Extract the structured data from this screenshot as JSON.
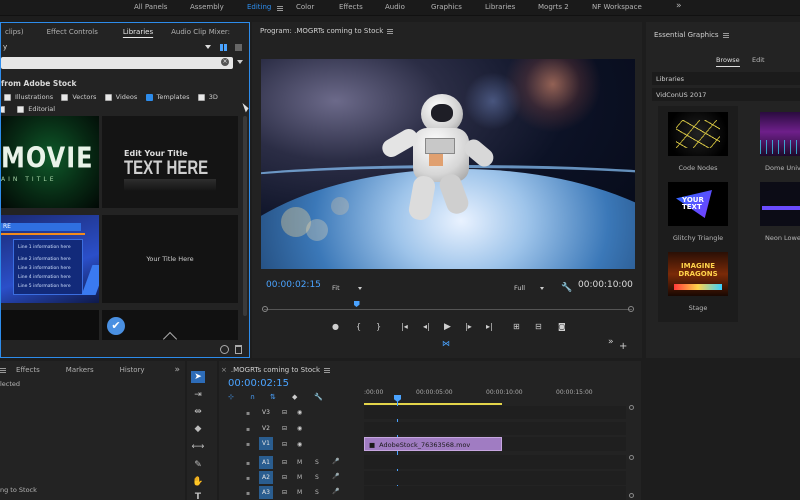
{
  "workspaces": [
    "All Panels",
    "Assembly",
    "Editing",
    "Color",
    "Effects",
    "Audio",
    "Graphics",
    "Libraries",
    "Mogrts 2",
    "NF Workspace"
  ],
  "workspace_more": "»",
  "libraries_panel": {
    "tabs": [
      "clips)",
      "Effect Controls",
      "Libraries",
      "Audio Clip Mixer:"
    ],
    "more": "»",
    "dropdown_value": "y",
    "search_value": "",
    "section_title": "from Adobe Stock",
    "filters": [
      {
        "label": "Illustrations",
        "checked": false
      },
      {
        "label": "Vectors",
        "checked": false
      },
      {
        "label": "Videos",
        "checked": false
      },
      {
        "label": "Templates",
        "checked": true
      },
      {
        "label": "3D",
        "checked": false
      },
      {
        "label": "Editorial",
        "checked": false
      }
    ],
    "thumbs": {
      "movie_big": "MOVIE",
      "movie_sub": "AIN TITLE",
      "text_small": "Edit Your Title",
      "text_big": "TEXT HERE",
      "list_header": "RE",
      "list_items": [
        "Line 1 information here",
        "Line 2 information here",
        "Line 3 information here",
        "Line 4 information here",
        "Line 5 information here"
      ],
      "your_title": "Your Title Here"
    }
  },
  "program_monitor": {
    "title": "Program: .MOGRTs coming to Stock",
    "timecode": "00:00:02:15",
    "fit": "Fit",
    "quality": "Full",
    "duration": "00:00:10:00",
    "playhead_fraction": 0.25
  },
  "essential_graphics": {
    "title": "Essential Graphics",
    "tabs": [
      "Browse",
      "Edit"
    ],
    "libraries_label": "Libraries",
    "library_value": "VidConUS 2017",
    "items": [
      {
        "label": "Code Nodes"
      },
      {
        "label": "Dome Univ"
      },
      {
        "label": "Glitchy Triangle",
        "thumb_text": "YOUR TEXT"
      },
      {
        "label": "Neon Lower"
      },
      {
        "label": "Stage",
        "thumb_text": "IMAGINE DRAGONS"
      }
    ]
  },
  "bottom_left_panel": {
    "tabs": [
      "Effects",
      "Markers",
      "History"
    ],
    "more": "»",
    "status": "lected",
    "footer": "ng to Stock"
  },
  "timeline": {
    "title": ".MOGRTs coming to Stock",
    "timecode": "00:00:02:15",
    "ruler": [
      ":00:00",
      "00:00:05:00",
      "00:00:10:00",
      "00:00:15:00"
    ],
    "video_tracks": [
      "V3",
      "V2",
      "V1"
    ],
    "audio_tracks": [
      "A1",
      "A2",
      "A3"
    ],
    "clip_name": "AdobeStock_76363568.mov"
  }
}
